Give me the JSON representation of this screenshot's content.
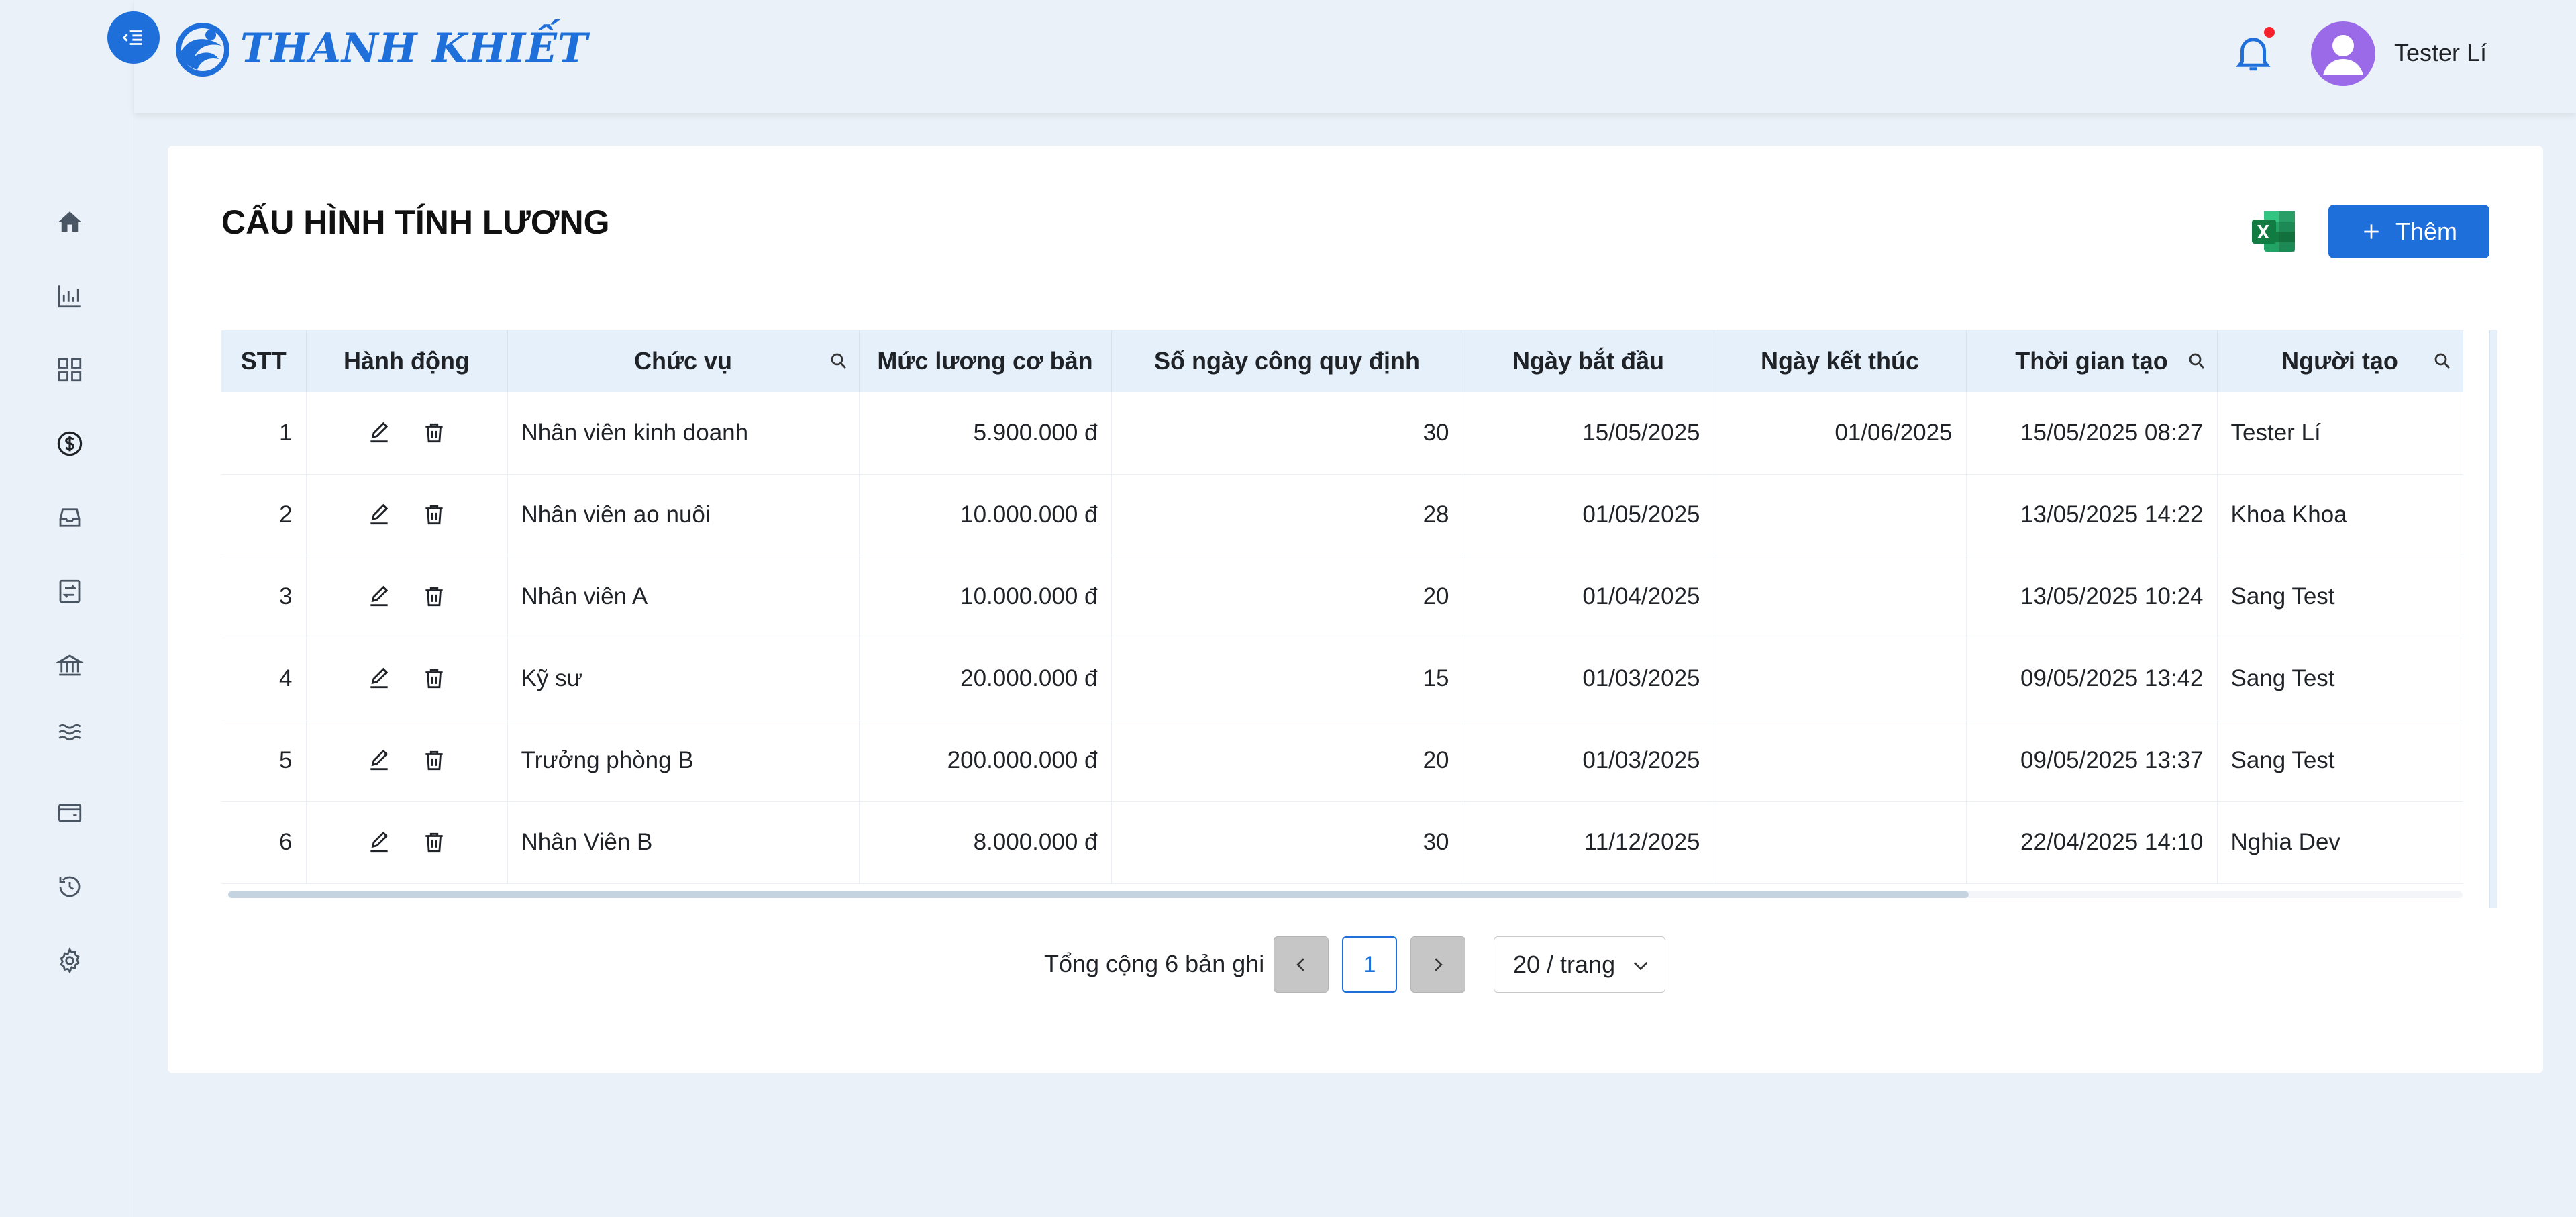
{
  "app": {
    "logo_text": "THANH KHIẾT",
    "user_name": "Tester Lí"
  },
  "icons": {
    "menu_toggle": "menu-fold-icon",
    "logo": "wave-logo-icon",
    "bell": "bell-icon",
    "avatar": "user-icon",
    "excel": "excel-icon",
    "add": "plus-icon",
    "edit": "edit-icon",
    "delete": "delete-icon",
    "search": "search-icon"
  },
  "colors": {
    "accent": "#1e6fd9",
    "notification_dot": "#f5222d",
    "avatar_bg": "#9b6ae8",
    "excel_green": "#1d7044"
  },
  "sidebar": {
    "items": [
      {
        "icon": "home-icon"
      },
      {
        "icon": "bar-chart-icon"
      },
      {
        "icon": "grid-icon"
      },
      {
        "icon": "dollar-icon",
        "active": true
      },
      {
        "icon": "inbox-icon"
      },
      {
        "icon": "transfer-icon"
      },
      {
        "icon": "bank-icon"
      },
      {
        "icon": "waves-icon"
      },
      {
        "icon": "wallet-icon"
      },
      {
        "icon": "history-icon"
      },
      {
        "icon": "setting-icon"
      }
    ]
  },
  "page": {
    "title": "CẤU HÌNH TÍNH LƯƠNG",
    "add_label": "Thêm"
  },
  "table": {
    "columns": [
      "STT",
      "Hành động",
      "Chức vụ",
      "Mức lương cơ bản",
      "Số ngày công quy định",
      "Ngày bắt đầu",
      "Ngày kết thúc",
      "Thời gian tạo",
      "Người tạo"
    ],
    "rows": [
      {
        "stt": "1",
        "position": "Nhân viên kinh doanh",
        "salary": "5.900.000 đ",
        "days": "30",
        "start": "15/05/2025",
        "end": "01/06/2025",
        "created": "15/05/2025 08:27",
        "creator": "Tester Lí"
      },
      {
        "stt": "2",
        "position": "Nhân viên ao nuôi",
        "salary": "10.000.000 đ",
        "days": "28",
        "start": "01/05/2025",
        "end": "",
        "created": "13/05/2025 14:22",
        "creator": "Khoa Khoa"
      },
      {
        "stt": "3",
        "position": "Nhân viên A",
        "salary": "10.000.000 đ",
        "days": "20",
        "start": "01/04/2025",
        "end": "",
        "created": "13/05/2025 10:24",
        "creator": "Sang Test"
      },
      {
        "stt": "4",
        "position": "Kỹ sư",
        "salary": "20.000.000 đ",
        "days": "15",
        "start": "01/03/2025",
        "end": "",
        "created": "09/05/2025 13:42",
        "creator": "Sang Test"
      },
      {
        "stt": "5",
        "position": "Trưởng phòng B",
        "salary": "200.000.000 đ",
        "days": "20",
        "start": "01/03/2025",
        "end": "",
        "created": "09/05/2025 13:37",
        "creator": "Sang Test"
      },
      {
        "stt": "6",
        "position": "Nhân Viên B",
        "salary": "8.000.000 đ",
        "days": "30",
        "start": "11/12/2025",
        "end": "",
        "created": "22/04/2025 14:10",
        "creator": "Nghia Dev"
      }
    ]
  },
  "pagination": {
    "total_text": "Tổng cộng 6 bản ghi",
    "current_page": "1",
    "page_size": "20 / trang"
  }
}
